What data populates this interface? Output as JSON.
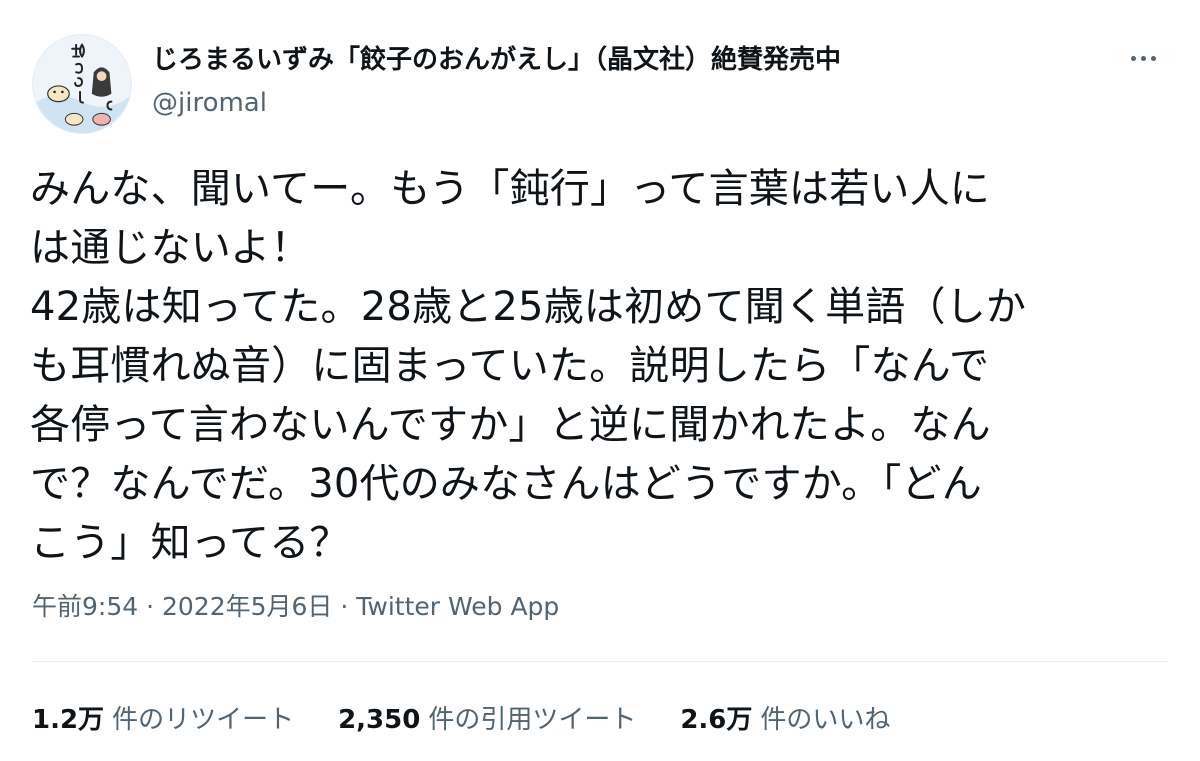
{
  "author": {
    "display_name": "じろまるいずみ「餃子のおんがえし」（晶文社）絶賛発売中",
    "handle": "@jiromal",
    "avatar_text": "餃子のおんがえし"
  },
  "tweet": {
    "lines": [
      "みんな、聞いてー。もう「鈍行」って言葉は若い人に",
      "は通じないよ！",
      "42歳は知ってた。28歳と25歳は初めて聞く単語（しか",
      "も耳慣れぬ音）に固まっていた。説明したら「なんで",
      "各停って言わないんですか」と逆に聞かれたよ。なん",
      "で？なんでだ。30代のみなさんはどうですか。「どん",
      "こう」知ってる？"
    ]
  },
  "meta": {
    "time": "午前9:54",
    "separator1": " · ",
    "date": "2022年5月6日",
    "separator2": " · ",
    "source": "Twitter Web App"
  },
  "stats": {
    "retweets": {
      "count": "1.2万",
      "label": "件のリツイート"
    },
    "quotes": {
      "count": "2,350",
      "label": "件の引用ツイート"
    },
    "likes": {
      "count": "2.6万",
      "label": "件のいいね"
    }
  },
  "icons": {
    "more": "more-horizontal-icon"
  },
  "colors": {
    "text": "#0f1419",
    "secondary": "#536471",
    "divider": "#e6ecf0"
  }
}
